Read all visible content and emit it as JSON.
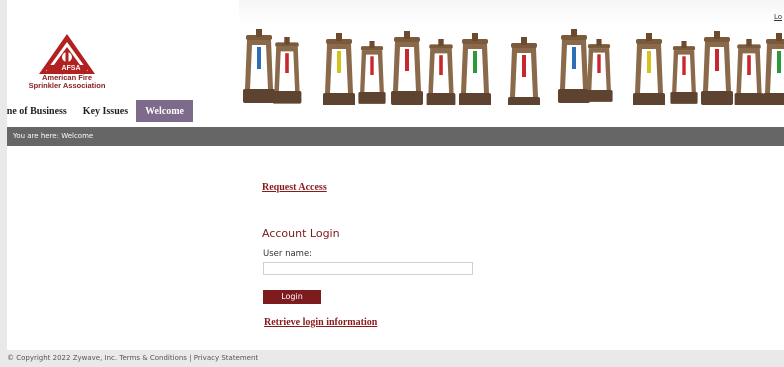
{
  "header": {
    "top_link": "Lo",
    "logo_text_line1": "American Fire",
    "logo_text_line2": "Sprinkler Association",
    "logo_badge": "AFSA",
    "banner_icons": "sprinkler-heads"
  },
  "nav": {
    "items": [
      {
        "label": "ine of Business"
      },
      {
        "label": "Key Issues"
      },
      {
        "label": "Welcome"
      }
    ],
    "active_color": "#7e6b8c"
  },
  "breadcrumb": {
    "text": "You are here: Welcome"
  },
  "main": {
    "request_access": "Request Access",
    "account_login_title": "Account Login",
    "username_label": "User name:",
    "username_value": "",
    "login_button": "Login",
    "retrieve_link": "Retrieve login information"
  },
  "footer": {
    "copyright": "© Copyright 2022 Zywave, Inc.",
    "terms": "Terms & Conditions",
    "separator": "|",
    "privacy": "Privacy Statement"
  },
  "colors": {
    "brand_red": "#8a1b1b",
    "button_bg": "#7d1c1f",
    "breadcrumb_bg": "#666666"
  }
}
